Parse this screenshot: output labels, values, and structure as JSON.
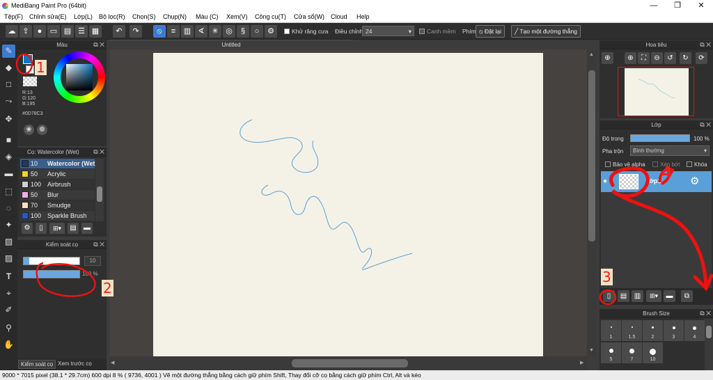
{
  "titlebar": {
    "title": "MediBang Paint Pro (64bit)",
    "min": "—",
    "max": "❐",
    "close": "✕"
  },
  "menu": [
    "Tệp(F)",
    "Chỉnh sửa(E)",
    "Lớp(L)",
    "Bộ lọc(R)",
    "Chọn(S)",
    "Chụp(N)",
    "Màu (C)",
    "Xem(V)",
    "Công cụ(T)",
    "Cửa sổ(W)",
    "Cloud",
    "Help"
  ],
  "toolbar": {
    "antialias_label": "Khử răng cưa",
    "adjust_label": "Điều chỉnh",
    "adjust_value": "24",
    "snap_label": "Canh mềm",
    "keys_label": "Phím",
    "reset_label": "Đặt lại",
    "line_label": "Tạo một đường thẳng"
  },
  "document": {
    "tab_title": "Untitled"
  },
  "color_panel": {
    "title": "Màu",
    "r": "R:13",
    "g": "G:120",
    "b": "B:195",
    "hex": "#0D78C3",
    "primary_color": "#0D78C3"
  },
  "brush_panel": {
    "title": "Cọ: Watercolor (Wet)",
    "items": [
      {
        "size": "10",
        "name": "Watercolor (Wet)",
        "color": "#1a3a6a",
        "selected": true
      },
      {
        "size": "50",
        "name": "Acrylic",
        "color": "#f3d327"
      },
      {
        "size": "100",
        "name": "Airbrush",
        "color": "#d0d0d0"
      },
      {
        "size": "50",
        "name": "Blur",
        "color": "#f2b0e4"
      },
      {
        "size": "70",
        "name": "Smudge",
        "color": "#f7dfc0"
      },
      {
        "size": "100",
        "name": "Sparkle Brush",
        "color": "#2a55cc"
      }
    ]
  },
  "brush_control": {
    "title": "Kiểm soát cọ",
    "size": "10",
    "opacity": "100 %",
    "size_fraction": 0.1,
    "opacity_fraction": 1.0
  },
  "bottom_tabs": {
    "tab1": "Kiểm soát cọ",
    "tab2": "Xem trước cọ"
  },
  "navigator": {
    "title": "Hoa tiêu"
  },
  "layer_panel": {
    "title": "Lớp",
    "opacity_label": "Độ trong",
    "opacity_value": "100 %",
    "blend_label": "Pha trộn",
    "blend_value": "Bình thường",
    "protect_alpha": "Bảo vệ alpha",
    "clipping": "Xén bớt",
    "lock": "Khóa",
    "layer_name": "Lớp1"
  },
  "brush_size": {
    "title": "Brush Size",
    "labels": [
      "1",
      "1.5",
      "2",
      "3",
      "4",
      "5",
      "7",
      "10"
    ]
  },
  "status": {
    "text": "9000 * 7015 pixel   (38.1 * 29.7cm)   600 dpi   8 %   ( 9736, 4001 )   Vẽ một đường thẳng bằng cách giữ phím Shift, Thay đổi cỡ cọ bằng cách giữ phím Ctrl, Alt và kéo"
  },
  "annotations": {
    "n1": "1",
    "n2": "2",
    "n3": "3",
    "n4": "4"
  }
}
